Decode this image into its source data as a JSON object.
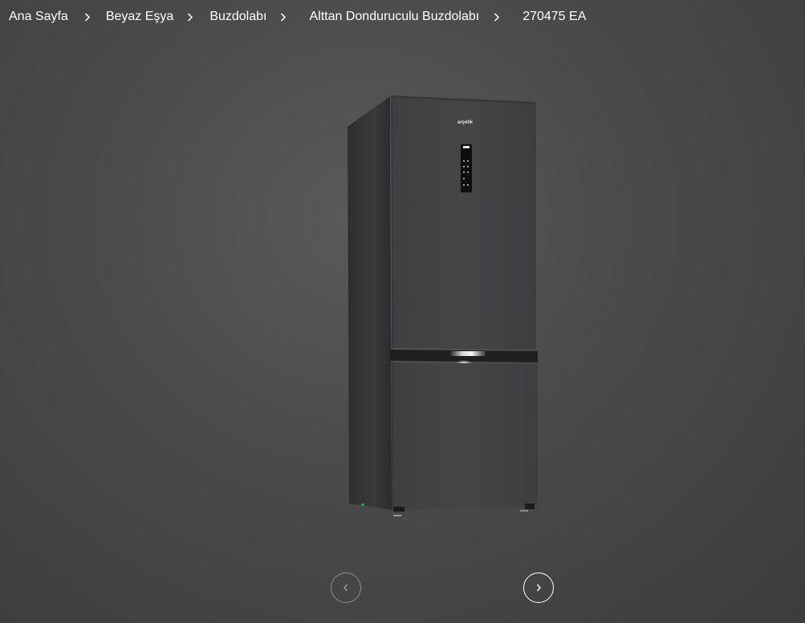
{
  "breadcrumb": {
    "items": [
      {
        "label": "Ana Sayfa"
      },
      {
        "label": "Beyaz Eşya"
      },
      {
        "label": "Buzdolabı"
      },
      {
        "label": "Alttan Donduruculu Buzdolabı"
      },
      {
        "label": "270475 EA"
      }
    ],
    "separator_icon": "chevron-right-icon"
  },
  "product": {
    "brand_logo": "arçelik"
  },
  "carousel": {
    "prev_icon": "chevron-left-icon",
    "next_icon": "chevron-right-icon",
    "prev_enabled": false,
    "next_enabled": true
  },
  "colors": {
    "background": "#4a4a4a",
    "text": "#ffffff",
    "disabled_border": "#8c8c8c"
  }
}
